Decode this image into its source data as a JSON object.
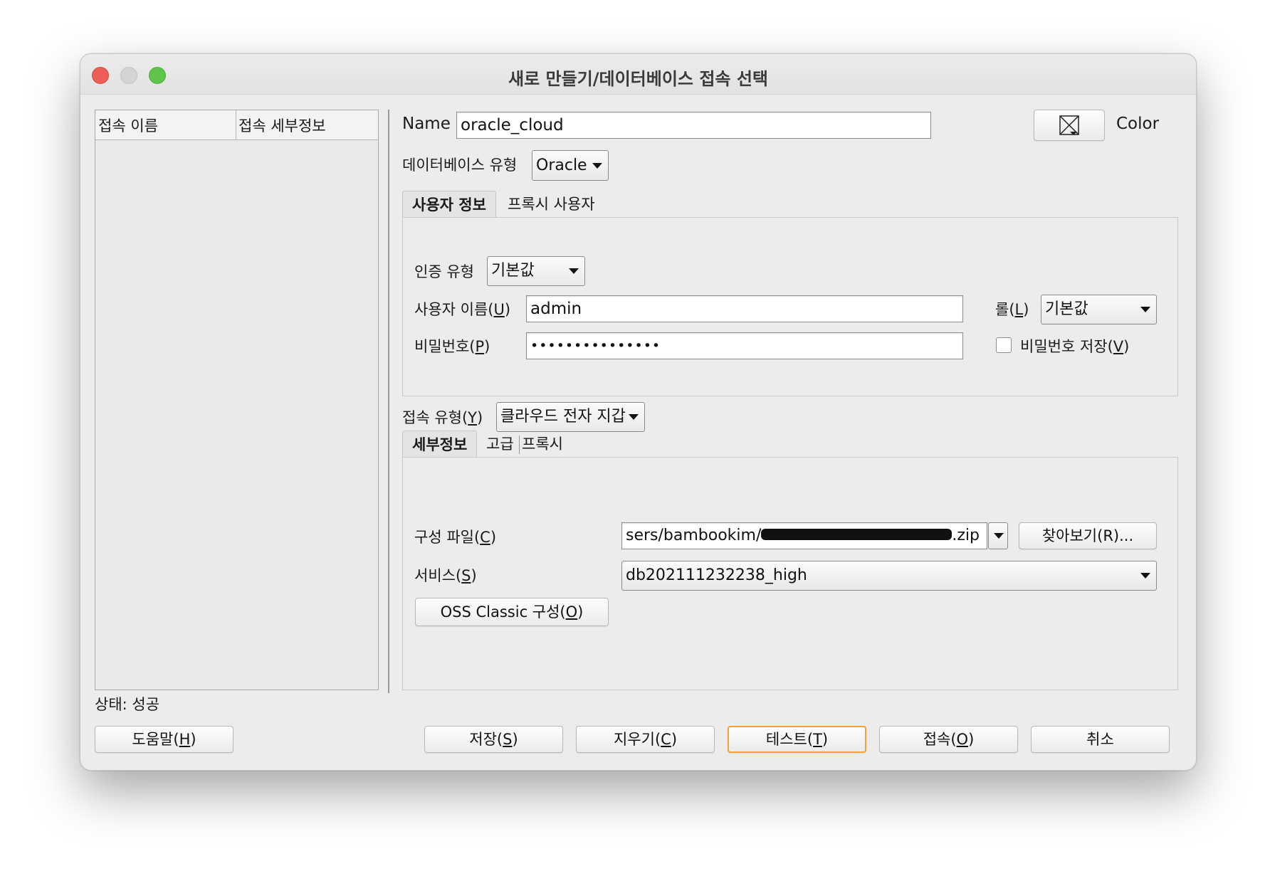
{
  "window": {
    "title": "새로 만들기/데이터베이스 접속 선택"
  },
  "list": {
    "col_name": "접속 이름",
    "col_details": "접속 세부정보",
    "status": "상태: 성공"
  },
  "form": {
    "name_label": "Name",
    "name_value": "oracle_cloud",
    "color_label": "Color",
    "db_type_label": "데이터베이스 유형",
    "db_type_value": "Oracle",
    "tabs": [
      "사용자 정보",
      "프록시 사용자"
    ],
    "auth_type_label": "인증 유형",
    "auth_type_value": "기본값",
    "username_label": "사용자 이름(",
    "username_key": "U",
    "username_value": "admin",
    "password_label": "비밀번호(",
    "password_key": "P",
    "password_value": "•••••••••••••••",
    "role_label": "롤(",
    "role_key": "L",
    "role_value": "기본값",
    "save_password_label": "비밀번호 저장(",
    "save_password_key": "V",
    "conn_type_label": "접속 유형(",
    "conn_type_key": "Y",
    "conn_type_value": "클라우드 전자 지갑",
    "detail_tabs": [
      "세부정보",
      "고급",
      "프록시"
    ],
    "config_file_label": "구성 파일(",
    "config_file_key": "C",
    "config_file_value": "sers/bambookim/",
    "config_file_suffix": ".zip",
    "browse_label": "찾아보기(R)...",
    "service_label": "서비스(",
    "service_key": "S",
    "service_value": "db202111232238_high",
    "oss_label": "OSS Classic 구성(",
    "oss_key": "O"
  },
  "buttons": {
    "help": "도움말(",
    "help_key": "H",
    "save": "저장(",
    "save_key": "S",
    "clear": "지우기(",
    "clear_key": "C",
    "test": "테스트(",
    "test_key": "T",
    "connect": "접속(",
    "connect_key": "O",
    "cancel": "취소"
  },
  "icons": {
    "color_picker": "no-color-icon",
    "dropdown": "chevron-down-icon"
  },
  "colors": {
    "focus_ring": "#f0a33a",
    "close": "#ec5f56",
    "zoom": "#5fc34c"
  }
}
